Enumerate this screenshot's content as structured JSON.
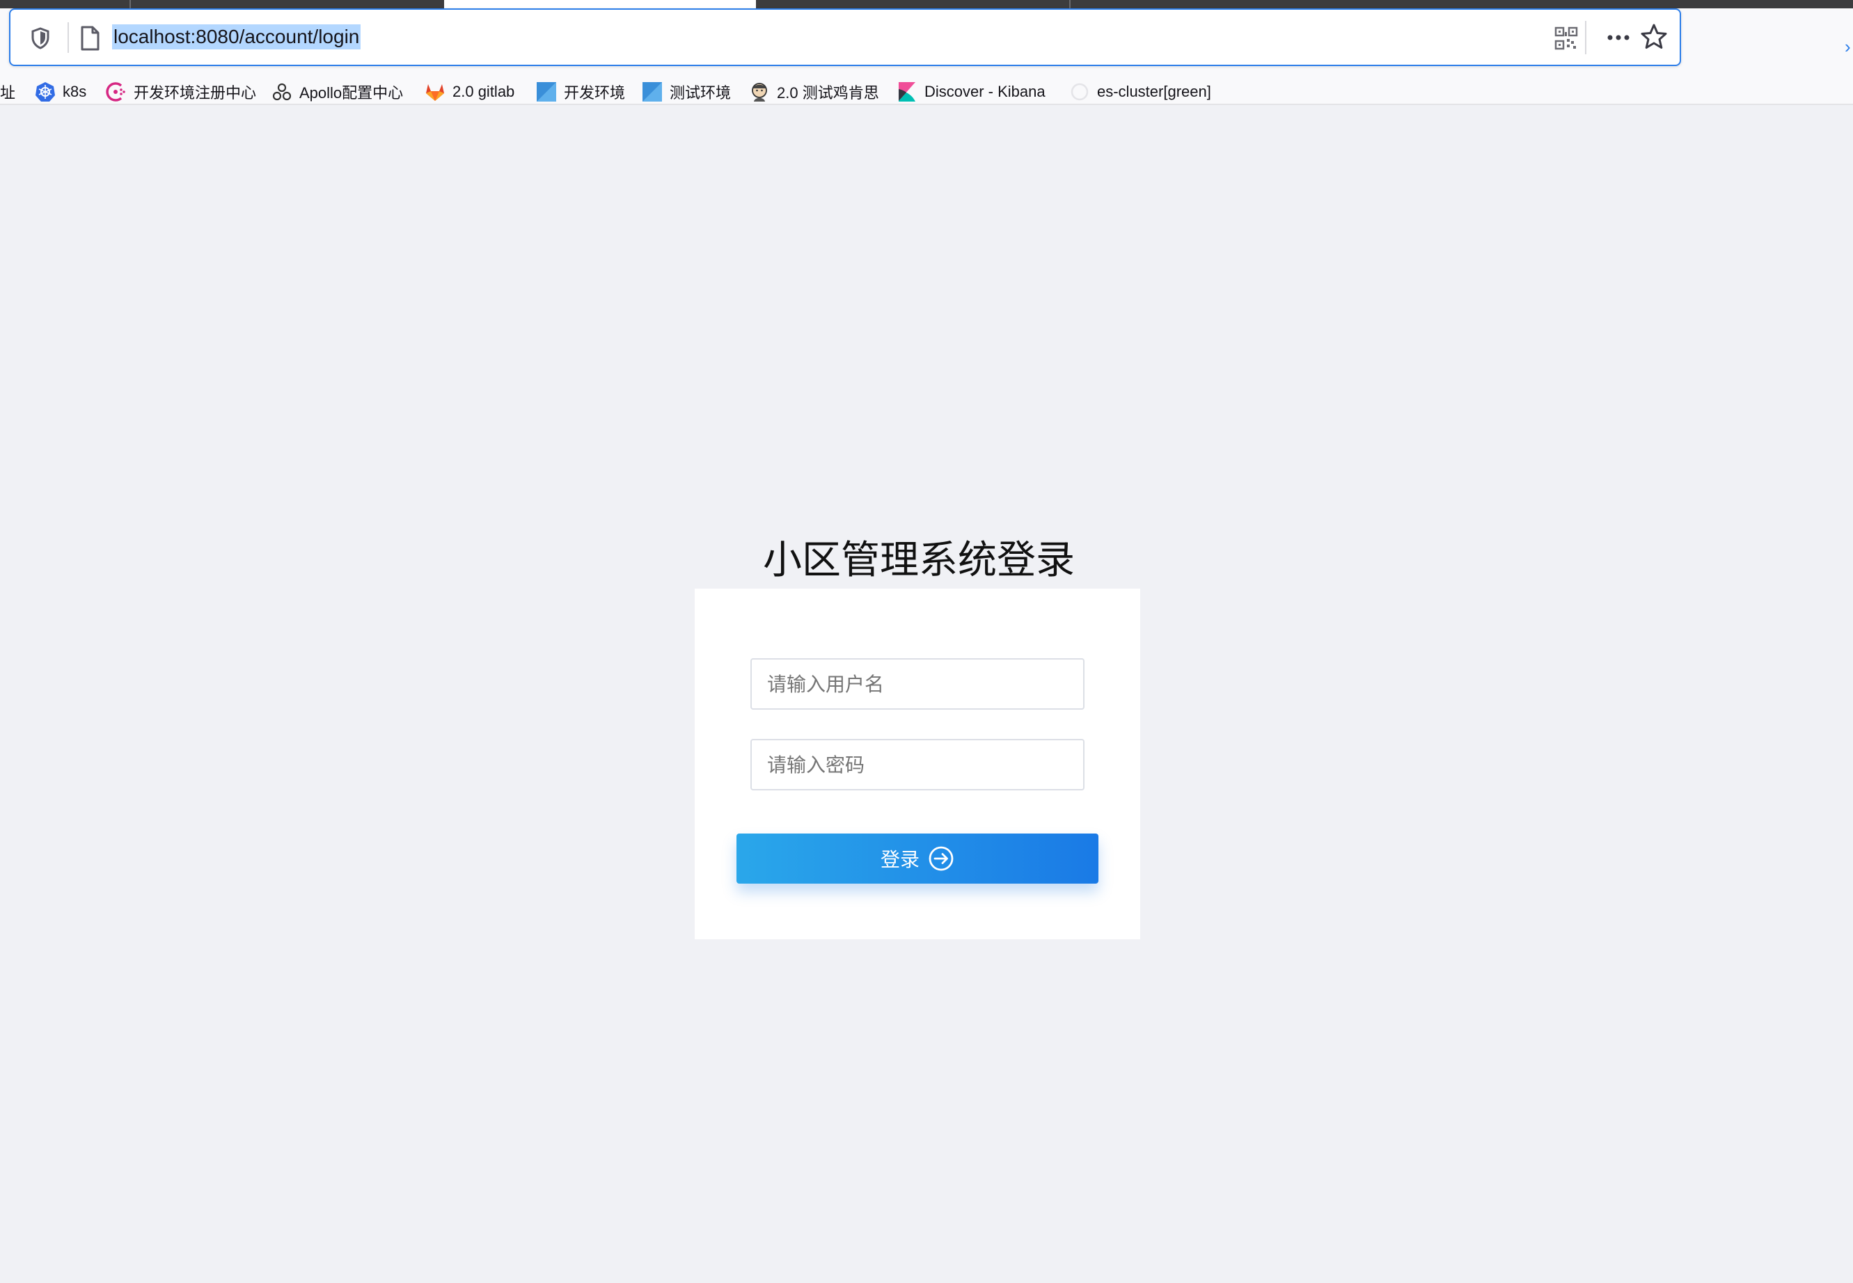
{
  "browser": {
    "url": "localhost:8080/account/login",
    "bookmarks": [
      {
        "label": "址",
        "icon": "none"
      },
      {
        "label": "k8s",
        "icon": "kubernetes-icon"
      },
      {
        "label": "开发环境注册中心",
        "icon": "consul-icon"
      },
      {
        "label": "Apollo配置中心",
        "icon": "apollo-icon"
      },
      {
        "label": "2.0 gitlab",
        "icon": "gitlab-icon"
      },
      {
        "label": "开发环境",
        "icon": "blue-square-icon"
      },
      {
        "label": "测试环境",
        "icon": "blue-square-icon"
      },
      {
        "label": "2.0 测试鸡肯思",
        "icon": "jenkins-icon"
      },
      {
        "label": "Discover - Kibana",
        "icon": "kibana-icon"
      },
      {
        "label": "es-cluster[green]",
        "icon": "globe-icon"
      }
    ]
  },
  "login": {
    "title": "小区管理系统登录",
    "username_placeholder": "请输入用户名",
    "password_placeholder": "请输入密码",
    "submit_label": "登录"
  },
  "colors": {
    "page_background": "#f0f1f5",
    "button_gradient_start": "#2aa7ea",
    "button_gradient_end": "#1a7ae6",
    "url_highlight": "#b3d7ff"
  }
}
